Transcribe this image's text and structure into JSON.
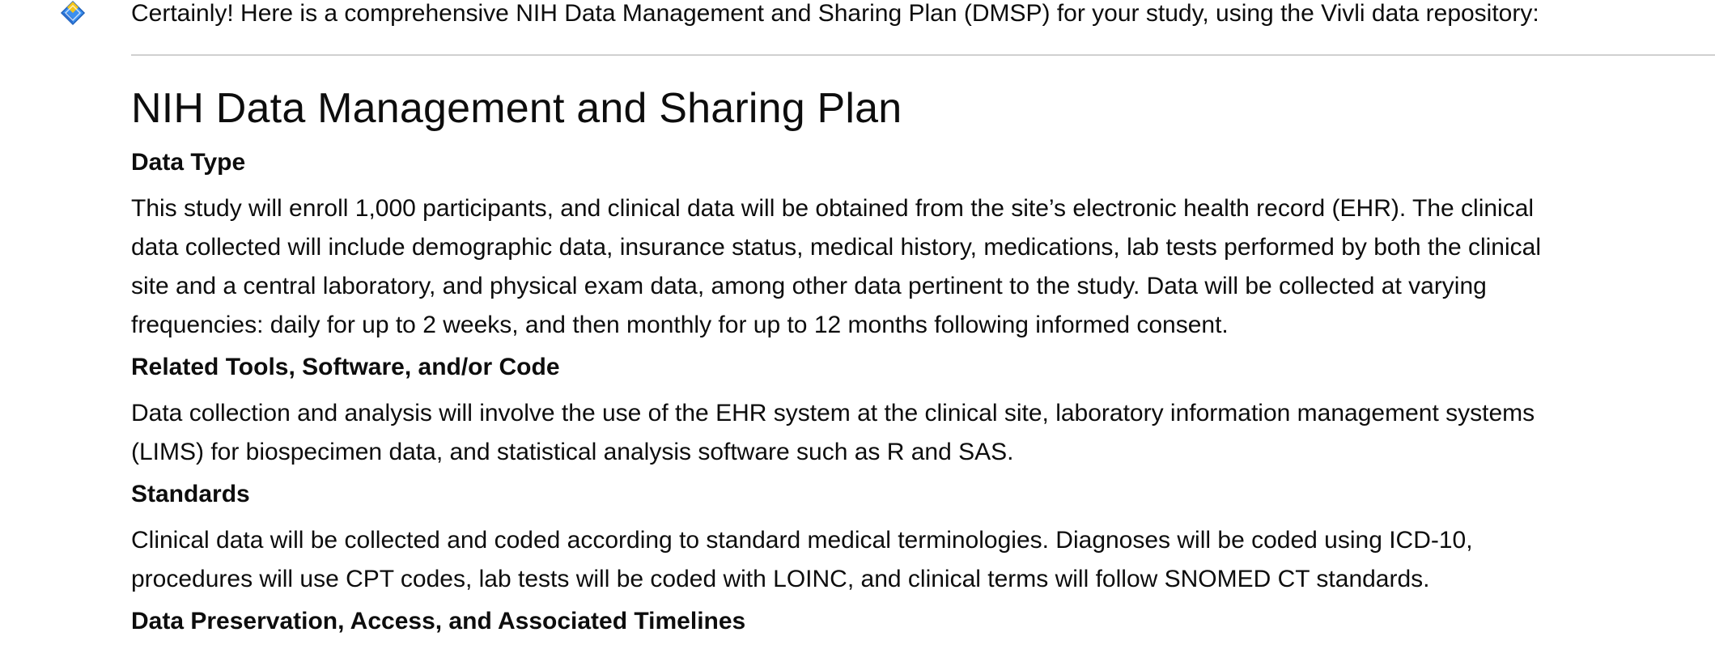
{
  "assistant": {
    "avatar_icon": "assistant-diamond-icon",
    "intro": "Certainly! Here is a comprehensive NIH Data Management and Sharing Plan (DMSP) for your study, using the Vivli data repository:"
  },
  "document": {
    "title": "NIH Data Management and Sharing Plan",
    "sections": [
      {
        "heading": "Data Type",
        "lines": [
          "This study will enroll 1,000 participants, and clinical data will be obtained from the site’s electronic health record (EHR). The clinical",
          "data collected will include demographic data, insurance status, medical history, medications, lab tests performed by both the clinical",
          "site and a central laboratory, and physical exam data, among other data pertinent to the study. Data will be collected at varying",
          "frequencies: daily for up to 2 weeks, and then monthly for up to 12 months following informed consent."
        ]
      },
      {
        "heading": "Related Tools, Software, and/or Code",
        "lines": [
          "Data collection and analysis will involve the use of the EHR system at the clinical site, laboratory information management systems",
          "(LIMS) for biospecimen data, and statistical analysis software such as R and SAS."
        ]
      },
      {
        "heading": "Standards",
        "lines": [
          "Clinical data will be collected and coded according to standard medical terminologies. Diagnoses will be coded using ICD-10,",
          "procedures will use CPT codes, lab tests will be coded with LOINC, and clinical terms will follow SNOMED CT standards."
        ]
      },
      {
        "heading": "Data Preservation, Access, and Associated Timelines",
        "lines": []
      }
    ]
  },
  "colors": {
    "text": "#0d0d0d",
    "divider": "#d0d0d0",
    "avatar_blue": "#3b8ff0",
    "avatar_yellow": "#f5c518"
  }
}
